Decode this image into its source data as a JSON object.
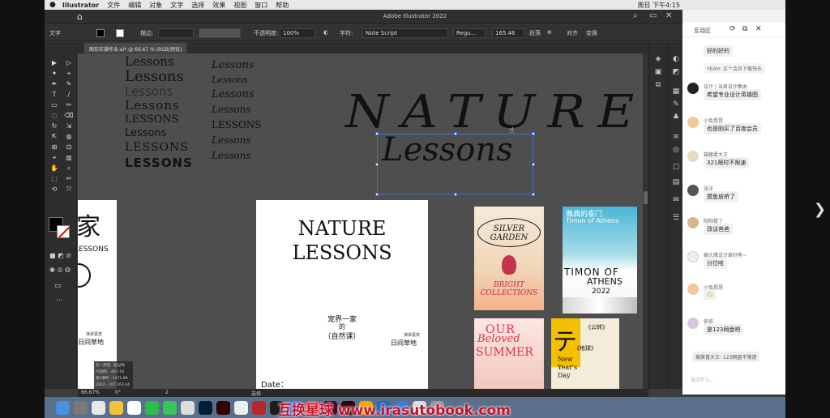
{
  "menubar": {
    "app_name": "Illustrator",
    "items": [
      "文件",
      "编辑",
      "对象",
      "文字",
      "选择",
      "效果",
      "视图",
      "窗口",
      "帮助"
    ],
    "clock": "周日 下午4:15"
  },
  "titlebar": {
    "title": "Adobe Illustrator 2022"
  },
  "controlbar": {
    "type_label": "文字",
    "stroke_label": "描边:",
    "opacity_label": "不透明度:",
    "opacity_value": "100%",
    "char_label": "字符:",
    "font_name": "Note Script",
    "font_style": "Regu...",
    "font_size": "165.46",
    "paragraph_label": "段落",
    "align_label": "对齐",
    "transform_label": "变换"
  },
  "doc_tab": {
    "label": "图形实操作业.ai* @ 66.67 % (RGB/预览)"
  },
  "canvas": {
    "lessons_col1": [
      "Lessons",
      "Lessons",
      "Lessons",
      "Lessons",
      "LESSONS",
      "Lessons",
      "LESSONS",
      "LESSONS"
    ],
    "lessons_col2": [
      "Lessons",
      "Lessons",
      "Lessons",
      "Lessons",
      "LESSONS",
      "Lessons",
      "Lessons"
    ],
    "headline_nature": "NATURE",
    "headline_lessons": "Lessons",
    "artboard_left_text": "LESSONS",
    "artboard_left_footer": "日间草地",
    "artboard_left_footer_small": "演讲嘉宾",
    "artboard_left_big": "家",
    "artboard_mid_title1": "NATURE",
    "artboard_mid_title2": "LESSONS",
    "artboard_mid_cn1": "宠界一家",
    "artboard_mid_cn2": "的",
    "artboard_mid_cn3": "（自然课）",
    "artboard_mid_small": "演讲嘉宾",
    "artboard_mid_footer": "日间草地",
    "artboard_mid_date": "Date："
  },
  "posters": {
    "silver_garden": "SILVER GARDEN",
    "bright_collections": "BRIGHT COLLECTIONS",
    "timon_cn": "雅典的泰门",
    "timon_en": "Timon of Athens",
    "timon_of": "TIMON OF",
    "timon_athens": "ATHENS",
    "timon_year": "2022",
    "our_summer_1": "OUR",
    "our_summer_2": "Beloved",
    "our_summer_3": "SUMMER",
    "newyear_big": "テ",
    "newyear_cn": "《地球》",
    "newyear_en": "New Year's Day",
    "newyear_small": "《公转》"
  },
  "statusbar": {
    "zoom": "66.67%",
    "rotation": "0°",
    "artboard": "2",
    "mode": "选择"
  },
  "left_overlay": {
    "lines": [
      "先一步回 - 超过你",
      "PS进阶 - 4K1-16",
      "第1课时 - 1471.88",
      "2022 - 107-163.44"
    ]
  },
  "chat": {
    "tab_label": "互动区",
    "messages": [
      {
        "name": "",
        "text": "好的好的"
      },
      {
        "name": "",
        "text": "YEAH: 买个会员下载快乐"
      },
      {
        "name": "设计 | 当君设计集由",
        "text": "希望专业设计英雄图"
      },
      {
        "name": "小兔晃晃",
        "text": "也是刚买了百度会员"
      },
      {
        "name": "猫腰柔大王",
        "text": "321限时不限速"
      },
      {
        "name": "张洋",
        "text": "摸鱼放桥了"
      },
      {
        "name": "阳阳楼了",
        "text": "改谈爸爸"
      },
      {
        "name": "猫头鹰设计爱好者~",
        "text": "分位哈"
      },
      {
        "name": "小兔晃晃",
        "text": ""
      },
      {
        "name": "依依",
        "text": "是123网盘吧"
      },
      {
        "name": "",
        "text": "搞笑喜大王: 123网盘不限速"
      }
    ],
    "input_placeholder": "说点什么..."
  },
  "watermark": "互换星球 www.irasutobook.com",
  "colors": {
    "selection": "#3b6cd4",
    "canvas": "#4e4e4e",
    "watermark": "#c8102e"
  }
}
